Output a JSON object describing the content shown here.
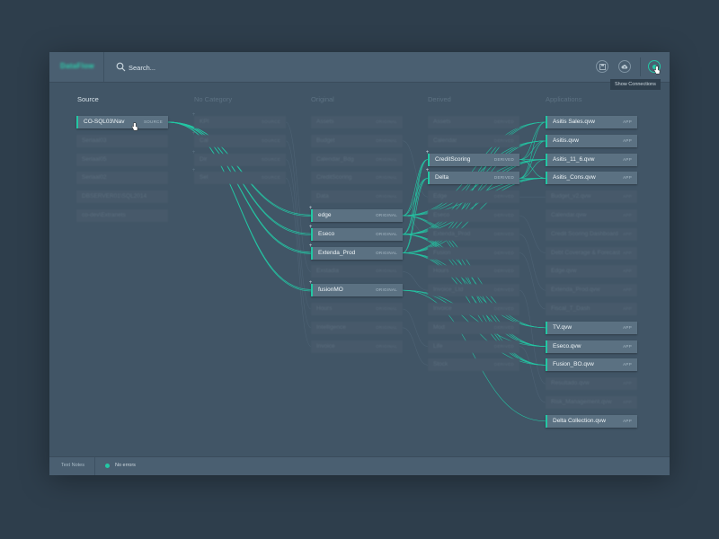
{
  "app": {
    "logo_text": "DataFlow"
  },
  "search": {
    "placeholder": "Search..."
  },
  "toolbar": {
    "tooltip": "Show Connections"
  },
  "columns": {
    "source": "Source",
    "no_category": "No Category",
    "original": "Original",
    "derived": "Derived",
    "applications": "Applications"
  },
  "source_nodes": [
    {
      "label": "CO-SQL03\\Nav",
      "tag": "SOURCE",
      "active": true
    },
    {
      "label": "Seriaal03",
      "tag": "",
      "active": false
    },
    {
      "label": "Seriaal05",
      "tag": "",
      "active": false
    },
    {
      "label": "Seriaal02",
      "tag": "",
      "active": false
    },
    {
      "label": "DBSERVER01\\SQL2014",
      "tag": "",
      "active": false
    },
    {
      "label": "co-dev\\Extranets",
      "tag": "",
      "active": false
    }
  ],
  "nocat_nodes": [
    {
      "label": "KPI",
      "tag": "SOURCE"
    },
    {
      "label": "Cal",
      "tag": "SOURCE"
    },
    {
      "label": "Dir",
      "tag": "SOURCE"
    },
    {
      "label": "Sel",
      "tag": "SOURCE"
    }
  ],
  "original_nodes": [
    {
      "label": "Assets",
      "tag": "ORIGINAL",
      "active": false
    },
    {
      "label": "Budget",
      "tag": "ORIGINAL",
      "active": false
    },
    {
      "label": "Calendar_Bdg",
      "tag": "ORIGINAL",
      "active": false
    },
    {
      "label": "CreditScoring",
      "tag": "ORIGINAL",
      "active": false
    },
    {
      "label": "Data",
      "tag": "ORIGINAL",
      "active": false
    },
    {
      "label": "edge",
      "tag": "ORIGINAL",
      "active": true
    },
    {
      "label": "Eseco",
      "tag": "ORIGINAL",
      "active": true
    },
    {
      "label": "Extenda_Prod",
      "tag": "ORIGINAL",
      "active": true
    },
    {
      "label": "Exstadia",
      "tag": "ORIGINAL",
      "active": false
    },
    {
      "label": "fusionMO",
      "tag": "ORIGINAL",
      "active": true
    },
    {
      "label": "Hours",
      "tag": "ORIGINAL",
      "active": false
    },
    {
      "label": "Intelligence",
      "tag": "ORIGINAL",
      "active": false
    },
    {
      "label": "Invoice",
      "tag": "ORIGINAL",
      "active": false
    }
  ],
  "derived_nodes": [
    {
      "label": "Assets",
      "tag": "DERIVED",
      "active": false
    },
    {
      "label": "Calendar",
      "tag": "DERIVED",
      "active": false
    },
    {
      "label": "CreditScoring",
      "tag": "DERIVED",
      "active": true
    },
    {
      "label": "Delta",
      "tag": "DERIVED",
      "active": true
    },
    {
      "label": "Edge",
      "tag": "DERIVED",
      "active": false
    },
    {
      "label": "Eseco",
      "tag": "DERIVED",
      "active": false
    },
    {
      "label": "Extenda_Prod",
      "tag": "DERIVED",
      "active": false
    },
    {
      "label": "Fusion",
      "tag": "DERIVED",
      "active": false
    },
    {
      "label": "Hours",
      "tag": "DERIVED",
      "active": false
    },
    {
      "label": "Invoice_Ltd",
      "tag": "DERIVED",
      "active": false
    },
    {
      "label": "Invoice",
      "tag": "DERIVED",
      "active": false
    },
    {
      "label": "Mod",
      "tag": "DERIVED",
      "active": false
    },
    {
      "label": "Life",
      "tag": "DERIVED",
      "active": false
    },
    {
      "label": "Stock",
      "tag": "DERIVED",
      "active": false
    }
  ],
  "app_nodes": [
    {
      "label": "Asitis Sales.qvw",
      "tag": "APP",
      "active": true
    },
    {
      "label": "Asitis.qvw",
      "tag": "APP",
      "active": true
    },
    {
      "label": "Asitis_11_6.qvw",
      "tag": "APP",
      "active": true
    },
    {
      "label": "Asitis_Cons.qvw",
      "tag": "APP",
      "active": true
    },
    {
      "label": "Budget_v2.qvw",
      "tag": "APP",
      "active": false
    },
    {
      "label": "Calendar.qvw",
      "tag": "APP",
      "active": false
    },
    {
      "label": "Credit Scoring Dashboard",
      "tag": "APP",
      "active": false
    },
    {
      "label": "Debt Coverage & Forecast",
      "tag": "APP",
      "active": false
    },
    {
      "label": "Edge.qvw",
      "tag": "APP",
      "active": false
    },
    {
      "label": "Extenda_Prod.qvw",
      "tag": "APP",
      "active": false
    },
    {
      "label": "Fiscal_T_Dash",
      "tag": "APP",
      "active": false
    },
    {
      "label": "TV.qvw",
      "tag": "APP",
      "active": true
    },
    {
      "label": "Eseco.qvw",
      "tag": "APP",
      "active": true
    },
    {
      "label": "Fusion_BO.qvw",
      "tag": "APP",
      "active": true
    },
    {
      "label": "Resultado.qvw",
      "tag": "APP",
      "active": false
    },
    {
      "label": "Risk_Management.qvw",
      "tag": "APP",
      "active": false
    },
    {
      "label": "Delta Collection.qvw",
      "tag": "APP",
      "active": true
    }
  ],
  "statusbar": {
    "notes_label": "Text Notes",
    "status_text": "No errors"
  },
  "colors": {
    "accent": "#23c7a4",
    "background": "#415566",
    "node_active": "#5b7182"
  },
  "icons": {
    "search": "search-icon",
    "save": "save-icon",
    "cloud": "cloud-upload-icon",
    "connections": "connections-icon"
  }
}
